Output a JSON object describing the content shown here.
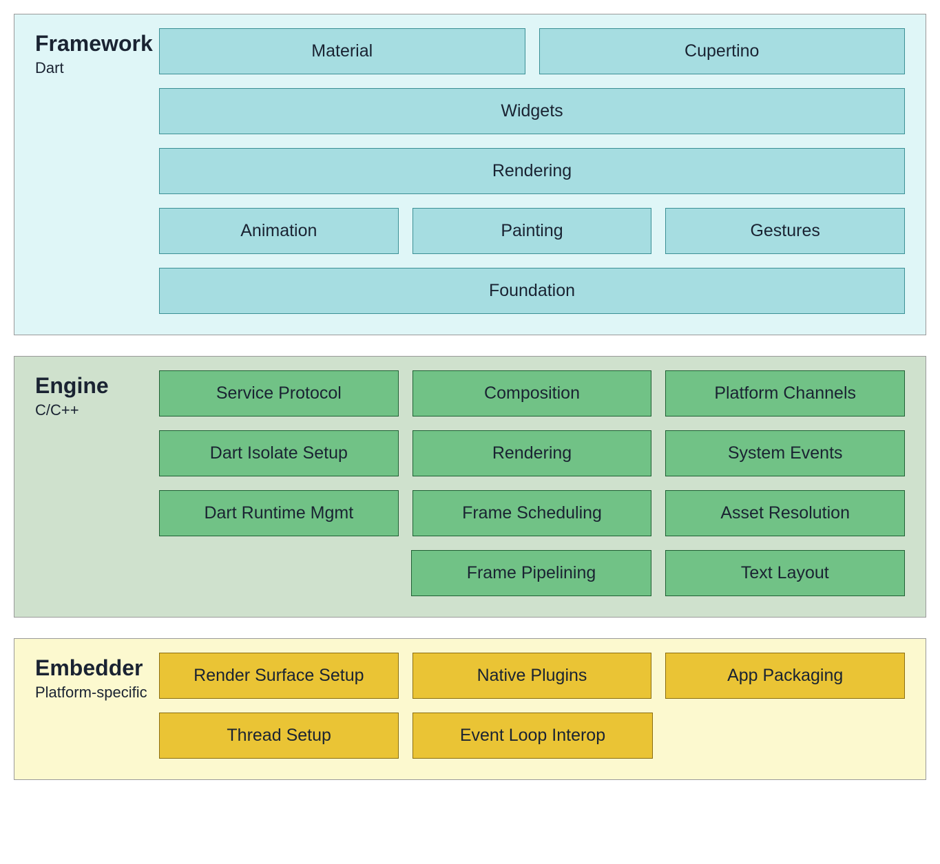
{
  "sections": [
    {
      "id": "framework",
      "title": "Framework",
      "subtitle": "Dart",
      "rows": [
        [
          "Material",
          "Cupertino"
        ],
        [
          "Widgets"
        ],
        [
          "Rendering"
        ],
        [
          "Animation",
          "Painting",
          "Gestures"
        ],
        [
          "Foundation"
        ]
      ]
    },
    {
      "id": "engine",
      "title": "Engine",
      "subtitle": "C/C++",
      "rows": [
        [
          "Service Protocol",
          "Composition",
          "Platform Channels"
        ],
        [
          "Dart Isolate Setup",
          "Rendering",
          "System Events"
        ],
        [
          "Dart Runtime Mgmt",
          "Frame Scheduling",
          "Asset Resolution"
        ],
        [
          "",
          "Frame Pipelining",
          "Text Layout"
        ]
      ]
    },
    {
      "id": "embedder",
      "title": "Embedder",
      "subtitle": "Platform-specific",
      "rows": [
        [
          "Render Surface Setup",
          "Native Plugins",
          "App Packaging"
        ],
        [
          "Thread Setup",
          "Event Loop Interop",
          ""
        ]
      ]
    }
  ]
}
